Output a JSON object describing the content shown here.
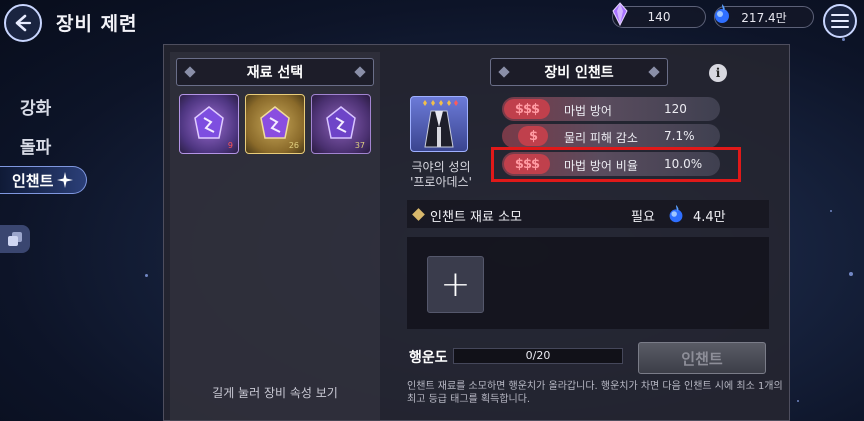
{
  "header": {
    "title": "장비 제련",
    "currency_crystal": "140",
    "currency_orb": "217.4만"
  },
  "sidebar": {
    "items": [
      {
        "label": "강화"
      },
      {
        "label": "돌파"
      },
      {
        "label": "인챈트"
      }
    ],
    "active_index": 2
  },
  "material_panel": {
    "title": "재료 선택",
    "slots": [
      {
        "type": "purple-crystal",
        "count": "9"
      },
      {
        "type": "gold-crystal",
        "count": "26"
      },
      {
        "type": "purple-crystal",
        "count": "37"
      }
    ],
    "hint": "길게 눌러 장비 속성 보기"
  },
  "enchant_panel": {
    "title": "장비 인챈트",
    "equipment_name_line1": "극야의 성의",
    "equipment_name_line2": "'프로아데스'",
    "stats": [
      {
        "badge": "$$$",
        "name": "마법 방어",
        "value": "120"
      },
      {
        "badge": "$",
        "name": "물리 피해 감소",
        "value": "7.1%"
      },
      {
        "badge": "$$$",
        "name": "마법 방어 비율",
        "value": "10.0%"
      }
    ],
    "highlighted_stat_index": 2,
    "consume": {
      "label": "인챈트 재료 소모",
      "required_label": "필요",
      "amount": "4.4만"
    },
    "add_material": "+",
    "luck": {
      "label": "행운도",
      "value": "0/20",
      "fraction": 0
    },
    "enchant_button": "인챈트",
    "note": "인챈트 재료를 소모하면 행운치가 올라갑니다. 행운치가 차면 다음 인챈트 시에 최소 1개의 최고 등급 태그를 획득합니다."
  },
  "colors": {
    "highlight": "#e01919",
    "stat_badge": "#c0404c",
    "accent": "#7f97df"
  }
}
